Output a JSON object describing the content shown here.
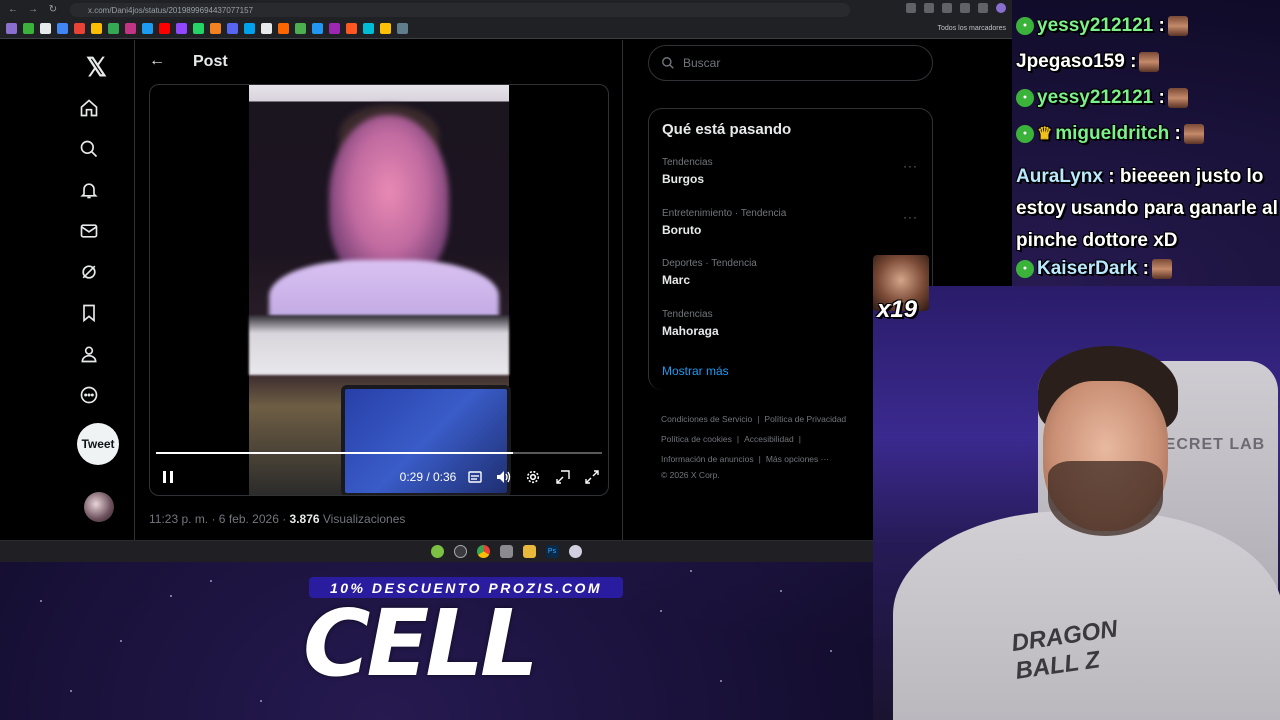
{
  "browser": {
    "url": "x.com/Dani4jos/status/2019899694437077157",
    "bookmarks_folder": "Todos los marcadores"
  },
  "sidebar": {
    "items": [
      {
        "name": "home"
      },
      {
        "name": "explore"
      },
      {
        "name": "notifications"
      },
      {
        "name": "messages"
      },
      {
        "name": "grok"
      },
      {
        "name": "bookmarks"
      },
      {
        "name": "profile"
      },
      {
        "name": "more"
      }
    ],
    "tweet_label": "Tweet"
  },
  "post": {
    "title": "Post",
    "video": {
      "time": "0:29 / 0:36",
      "progress": 0.8
    },
    "meta_time": "11:23 p. m. · 6 feb. 2026 · ",
    "views_count": "3.876",
    "views_label": " Visualizaciones"
  },
  "search": {
    "placeholder": "Buscar"
  },
  "trends": {
    "title": "Qué está pasando",
    "items": [
      {
        "category": "Tendencias",
        "name": "Burgos"
      },
      {
        "category": "Entretenimiento · Tendencia",
        "name": "Boruto"
      },
      {
        "category": "Deportes · Tendencia",
        "name": "Marc"
      },
      {
        "category": "Tendencias",
        "name": "Mahoraga"
      }
    ],
    "show_more": "Mostrar más"
  },
  "footer": {
    "terms": "Condiciones de Servicio",
    "privacy": "Política de Privacidad",
    "cookies": "Política de cookies",
    "accessibility": "Accesibilidad",
    "ads": "Información de anuncios",
    "more": "Más opciones ···",
    "copyright": "© 2026 X Corp."
  },
  "promo": {
    "strip": "10% DESCUENTO PROZIS.COM",
    "code": "CELL"
  },
  "chat": {
    "messages": [
      {
        "user": "yessy212121",
        "text": " :",
        "color": "#7cf08a",
        "badge": true
      },
      {
        "user": "Jpegaso159",
        "text": " :",
        "color": "#ffffff",
        "badge": false
      },
      {
        "user": "yessy212121",
        "text": " :",
        "color": "#7cf08a",
        "badge": true
      },
      {
        "user": "migueldritch",
        "text": " :",
        "color": "#7cf08a",
        "badge": true,
        "crown": true
      }
    ],
    "long_user": "AuraLynx",
    "long_user_color": "#b9e8ff",
    "long_text": " : bieeeen justo lo estoy usando para ganarle al pinche dottore xD",
    "last_user": "KaiserDark",
    "last_user_color": "#b9e8ff",
    "last_text": " :"
  },
  "overlay": {
    "emote_count": "x19"
  },
  "webcam": {
    "chair_text": "SECRET LAB",
    "shirt_text": "DRAGON BALL Z"
  }
}
